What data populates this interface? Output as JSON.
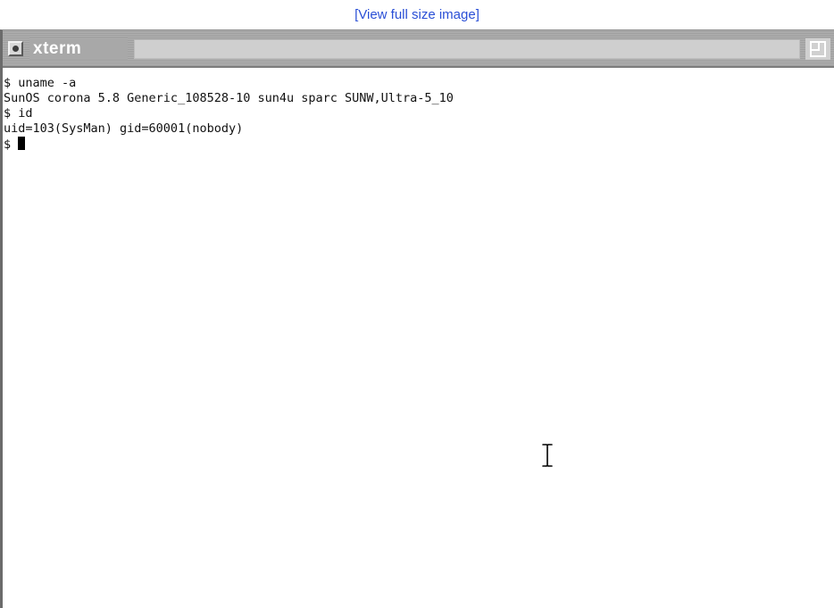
{
  "page": {
    "view_link": "[View full size image]"
  },
  "window": {
    "title": "xterm",
    "menu_button_icon": "window-menu-icon",
    "maximize_icon": "maximize-icon"
  },
  "terminal": {
    "lines": [
      "$ uname -a",
      "SunOS corona 5.8 Generic_108528-10 sun4u sparc SUNW,Ultra-5_10",
      "$ id",
      "uid=103(SysMan) gid=60001(nobody)"
    ],
    "prompt": "$ ",
    "mouse_cursor_icon": "i-beam-cursor-icon"
  }
}
